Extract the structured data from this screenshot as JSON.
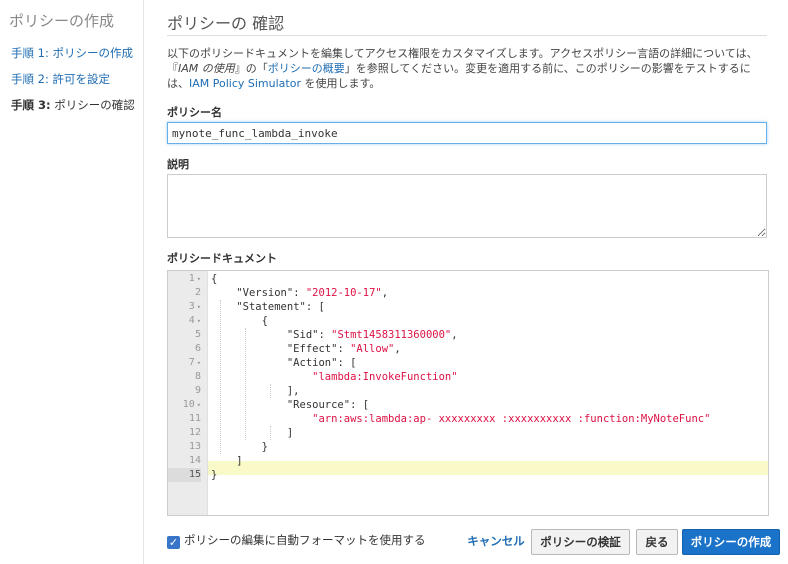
{
  "sidebar": {
    "title": "ポリシーの作成",
    "steps": [
      {
        "num": "手順 1:",
        "label": "ポリシーの作成"
      },
      {
        "num": "手順 2:",
        "label": "許可を設定"
      },
      {
        "num": "手順 3:",
        "label": "ポリシーの確認"
      }
    ]
  },
  "main": {
    "title": "ポリシーの 確認",
    "description": {
      "p1": "以下のポリシードキュメントを編集してアクセス権限をカスタマイズします。アクセスポリシー言語の詳細については、『",
      "p2": "IAM の使用",
      "p3": "』の「",
      "link1": "ポリシーの概要",
      "p4": "」を参照してください。変更を適用する前に、このポリシーの影響をテストするには、",
      "link2": "IAM Policy Simulator",
      "p5": " を使用します。"
    },
    "policy_name_label": "ポリシー名",
    "policy_name_value": "mynote_func_lambda_invoke",
    "description_label": "説明",
    "description_value": "",
    "policy_doc_label": "ポリシードキュメント"
  },
  "editor": {
    "line_numbers": [
      "1",
      "2",
      "3",
      "4",
      "5",
      "6",
      "7",
      "8",
      "9",
      "10",
      "11",
      "12",
      "13",
      "14",
      "15"
    ],
    "lines": [
      "{",
      "    \"Version\": \"2012-10-17\",",
      "    \"Statement\": [",
      "        {",
      "            \"Sid\": \"Stmt1458311360000\",",
      "            \"Effect\": \"Allow\",",
      "            \"Action\": [",
      "                \"lambda:InvokeFunction\"",
      "            ],",
      "            \"Resource\": [",
      "                \"arn:aws:lambda:ap- xxxxxxxxx :xxxxxxxxxx :function:MyNoteFunc\"",
      "            ]",
      "        }",
      "    ]",
      "}"
    ]
  },
  "footer": {
    "autoformat_label": "ポリシーの編集に自動フォーマットを使用する",
    "autoformat_checked": true,
    "cancel": "キャンセル",
    "validate": "ポリシーの検証",
    "back": "戻る",
    "create": "ポリシーの作成"
  },
  "colors": {
    "link": "#1f6db3",
    "primary": "#1a73c9",
    "string": "#dd1144"
  }
}
